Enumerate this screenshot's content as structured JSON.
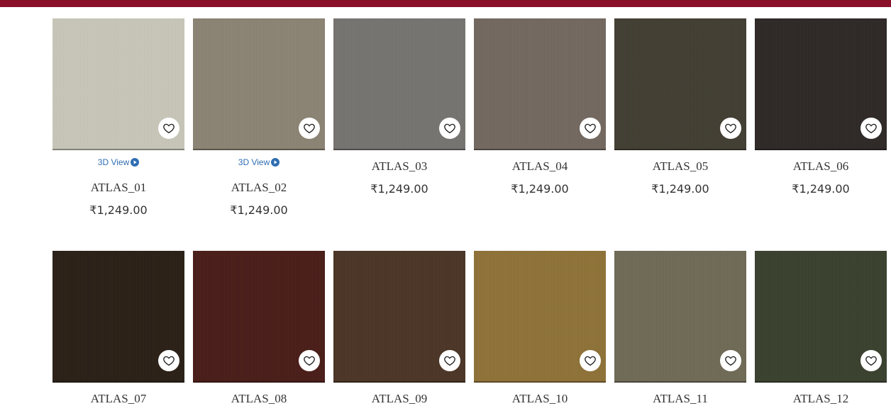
{
  "header": {
    "accent_color": "#8a1029"
  },
  "favorite_icon": "heart-outline-icon",
  "view3d_icon": "play-circle-icon",
  "products": [
    {
      "name": "ATLAS_01",
      "price": "₹1,249.00",
      "color": "#c8c6b8",
      "view3d_label": "3D View"
    },
    {
      "name": "ATLAS_02",
      "price": "₹1,249.00",
      "color": "#8b8373",
      "view3d_label": "3D View"
    },
    {
      "name": "ATLAS_03",
      "price": "₹1,249.00",
      "color": "#767470"
    },
    {
      "name": "ATLAS_04",
      "price": "₹1,249.00",
      "color": "#736860"
    },
    {
      "name": "ATLAS_05",
      "price": "₹1,249.00",
      "color": "#423e32"
    },
    {
      "name": "ATLAS_06",
      "price": "₹1,249.00",
      "color": "#2e2927"
    },
    {
      "name": "ATLAS_07",
      "price": "",
      "color": "#2a2016"
    },
    {
      "name": "ATLAS_08",
      "price": "",
      "color": "#4a1d18"
    },
    {
      "name": "ATLAS_09",
      "price": "",
      "color": "#4b3526"
    },
    {
      "name": "ATLAS_10",
      "price": "",
      "color": "#8e7237"
    },
    {
      "name": "ATLAS_11",
      "price": "",
      "color": "#6f6a56"
    },
    {
      "name": "ATLAS_12",
      "price": "",
      "color": "#39412e"
    }
  ]
}
